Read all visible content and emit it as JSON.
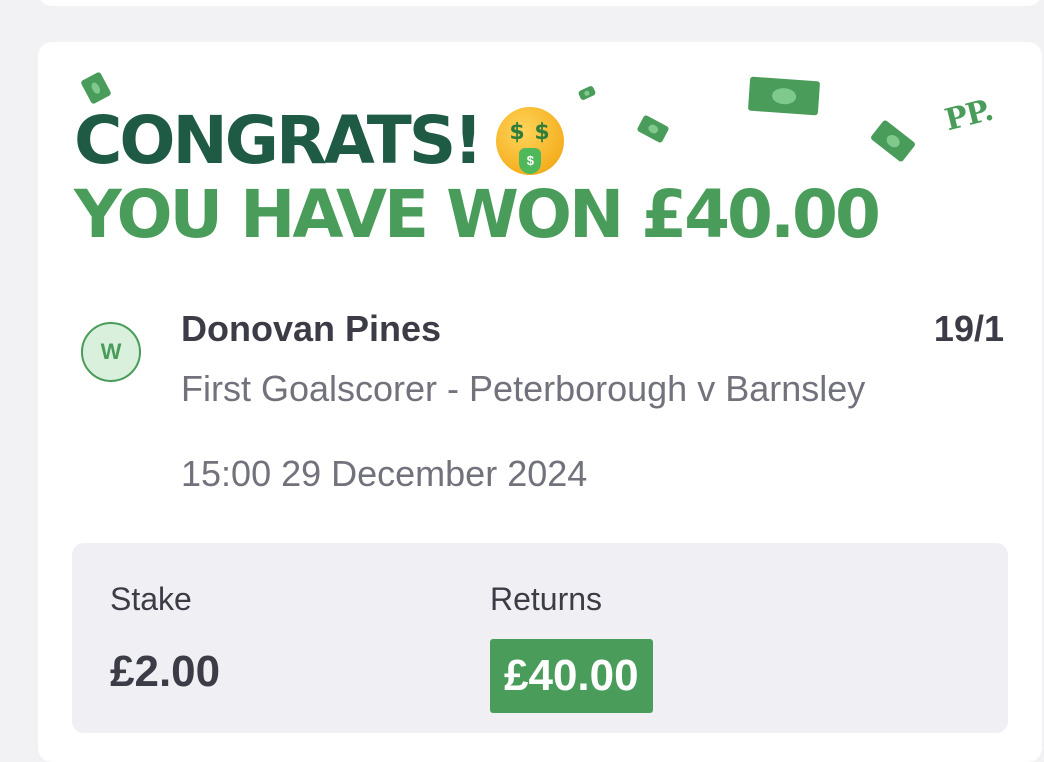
{
  "header": {
    "congrats": "CONGRATS!",
    "won_message": "YOU HAVE WON £40.00",
    "brand_badge": "PP.",
    "celebration_icon": "money-mouth-face-icon"
  },
  "bet": {
    "result_badge": "W",
    "selection": "Donovan Pines",
    "odds": "19/1",
    "market": "First Goalscorer - Peterborough v Barnsley",
    "event_time": "15:00 29 December 2024"
  },
  "summary": {
    "stake_label": "Stake",
    "stake_value": "£2.00",
    "returns_label": "Returns",
    "returns_value": "£40.00"
  },
  "colors": {
    "brand_dark_green": "#1f5a44",
    "brand_green": "#4a9c5a",
    "win_badge_bg": "#d8f0dc",
    "text_dark": "#3c3c46",
    "text_muted": "#72727c",
    "summary_bg": "#f0f0f4"
  }
}
